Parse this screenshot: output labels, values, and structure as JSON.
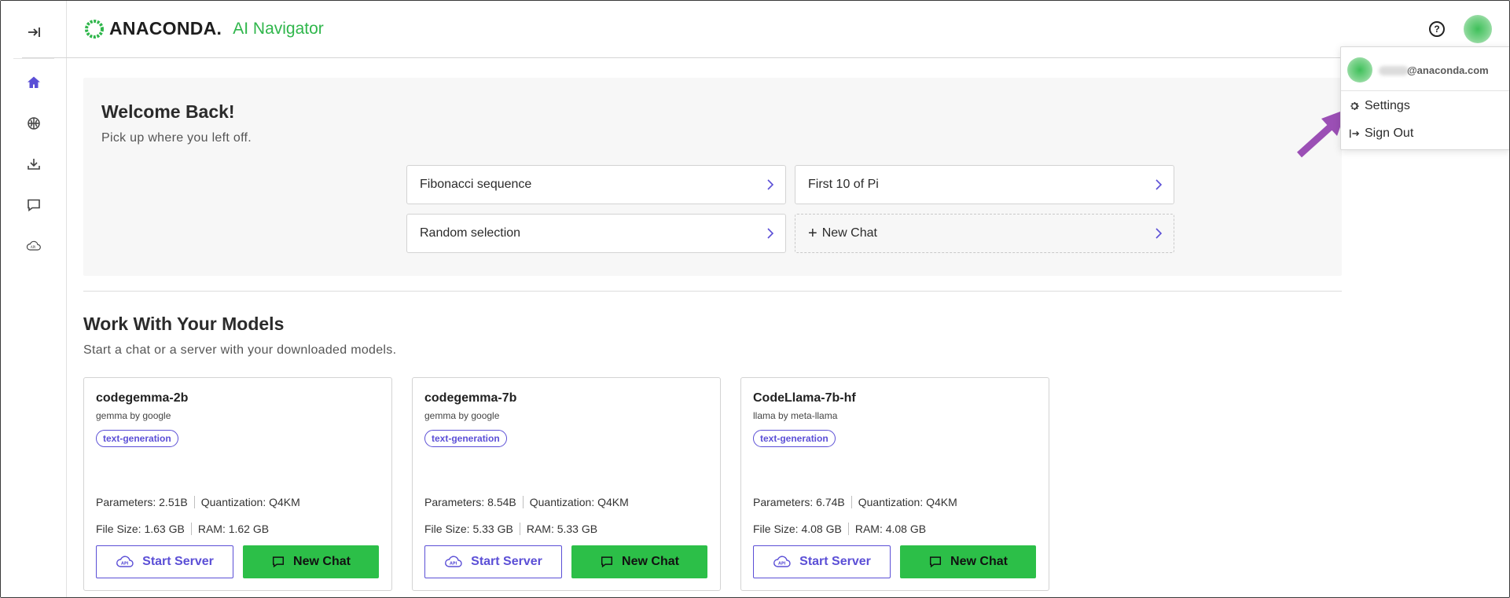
{
  "app": {
    "brand": "ANACONDA.",
    "product": "AI Navigator",
    "accent": "#5b4fd6",
    "brand_green": "#2fb64b",
    "button_green": "#2cbf48"
  },
  "sidebar": {
    "items": [
      {
        "name": "collapse",
        "icon": "collapse-arrow-icon"
      },
      {
        "name": "home",
        "icon": "home-icon",
        "active": true
      },
      {
        "name": "models",
        "icon": "brain-icon"
      },
      {
        "name": "downloads",
        "icon": "download-icon"
      },
      {
        "name": "chat",
        "icon": "chat-icon"
      },
      {
        "name": "api-server",
        "icon": "api-cloud-icon"
      }
    ]
  },
  "header": {
    "help_icon": "?"
  },
  "user_menu": {
    "email": "@anaconda.com",
    "items": [
      {
        "label": "Settings",
        "icon": "gear-icon"
      },
      {
        "label": "Sign Out",
        "icon": "sign-out-icon"
      }
    ]
  },
  "welcome": {
    "title": "Welcome Back!",
    "subtitle": "Pick up where you left off.",
    "chats": [
      {
        "label": "Fibonacci sequence"
      },
      {
        "label": "First 10 of Pi"
      },
      {
        "label": "Random selection"
      },
      {
        "label": "New Chat"
      }
    ]
  },
  "models_section": {
    "title": "Work With Your Models",
    "subtitle": "Start a chat or a server with your downloaded models.",
    "models": [
      {
        "name": "codegemma-2b",
        "org": "gemma by google",
        "tag": "text-generation",
        "parameters": "Parameters: 2.51B",
        "quantization": "Quantization: Q4KM",
        "file_size": "File Size: 1.63 GB",
        "ram": "RAM: 1.62 GB",
        "server_label": "Start Server",
        "chat_label": "New Chat"
      },
      {
        "name": "codegemma-7b",
        "org": "gemma by google",
        "tag": "text-generation",
        "parameters": "Parameters: 8.54B",
        "quantization": "Quantization: Q4KM",
        "file_size": "File Size: 5.33 GB",
        "ram": "RAM: 5.33 GB",
        "server_label": "Start Server",
        "chat_label": "New Chat"
      },
      {
        "name": "CodeLlama-7b-hf",
        "org": "llama by meta-llama",
        "tag": "text-generation",
        "parameters": "Parameters: 6.74B",
        "quantization": "Quantization: Q4KM",
        "file_size": "File Size: 4.08 GB",
        "ram": "RAM: 4.08 GB",
        "server_label": "Start Server",
        "chat_label": "New Chat"
      }
    ]
  }
}
